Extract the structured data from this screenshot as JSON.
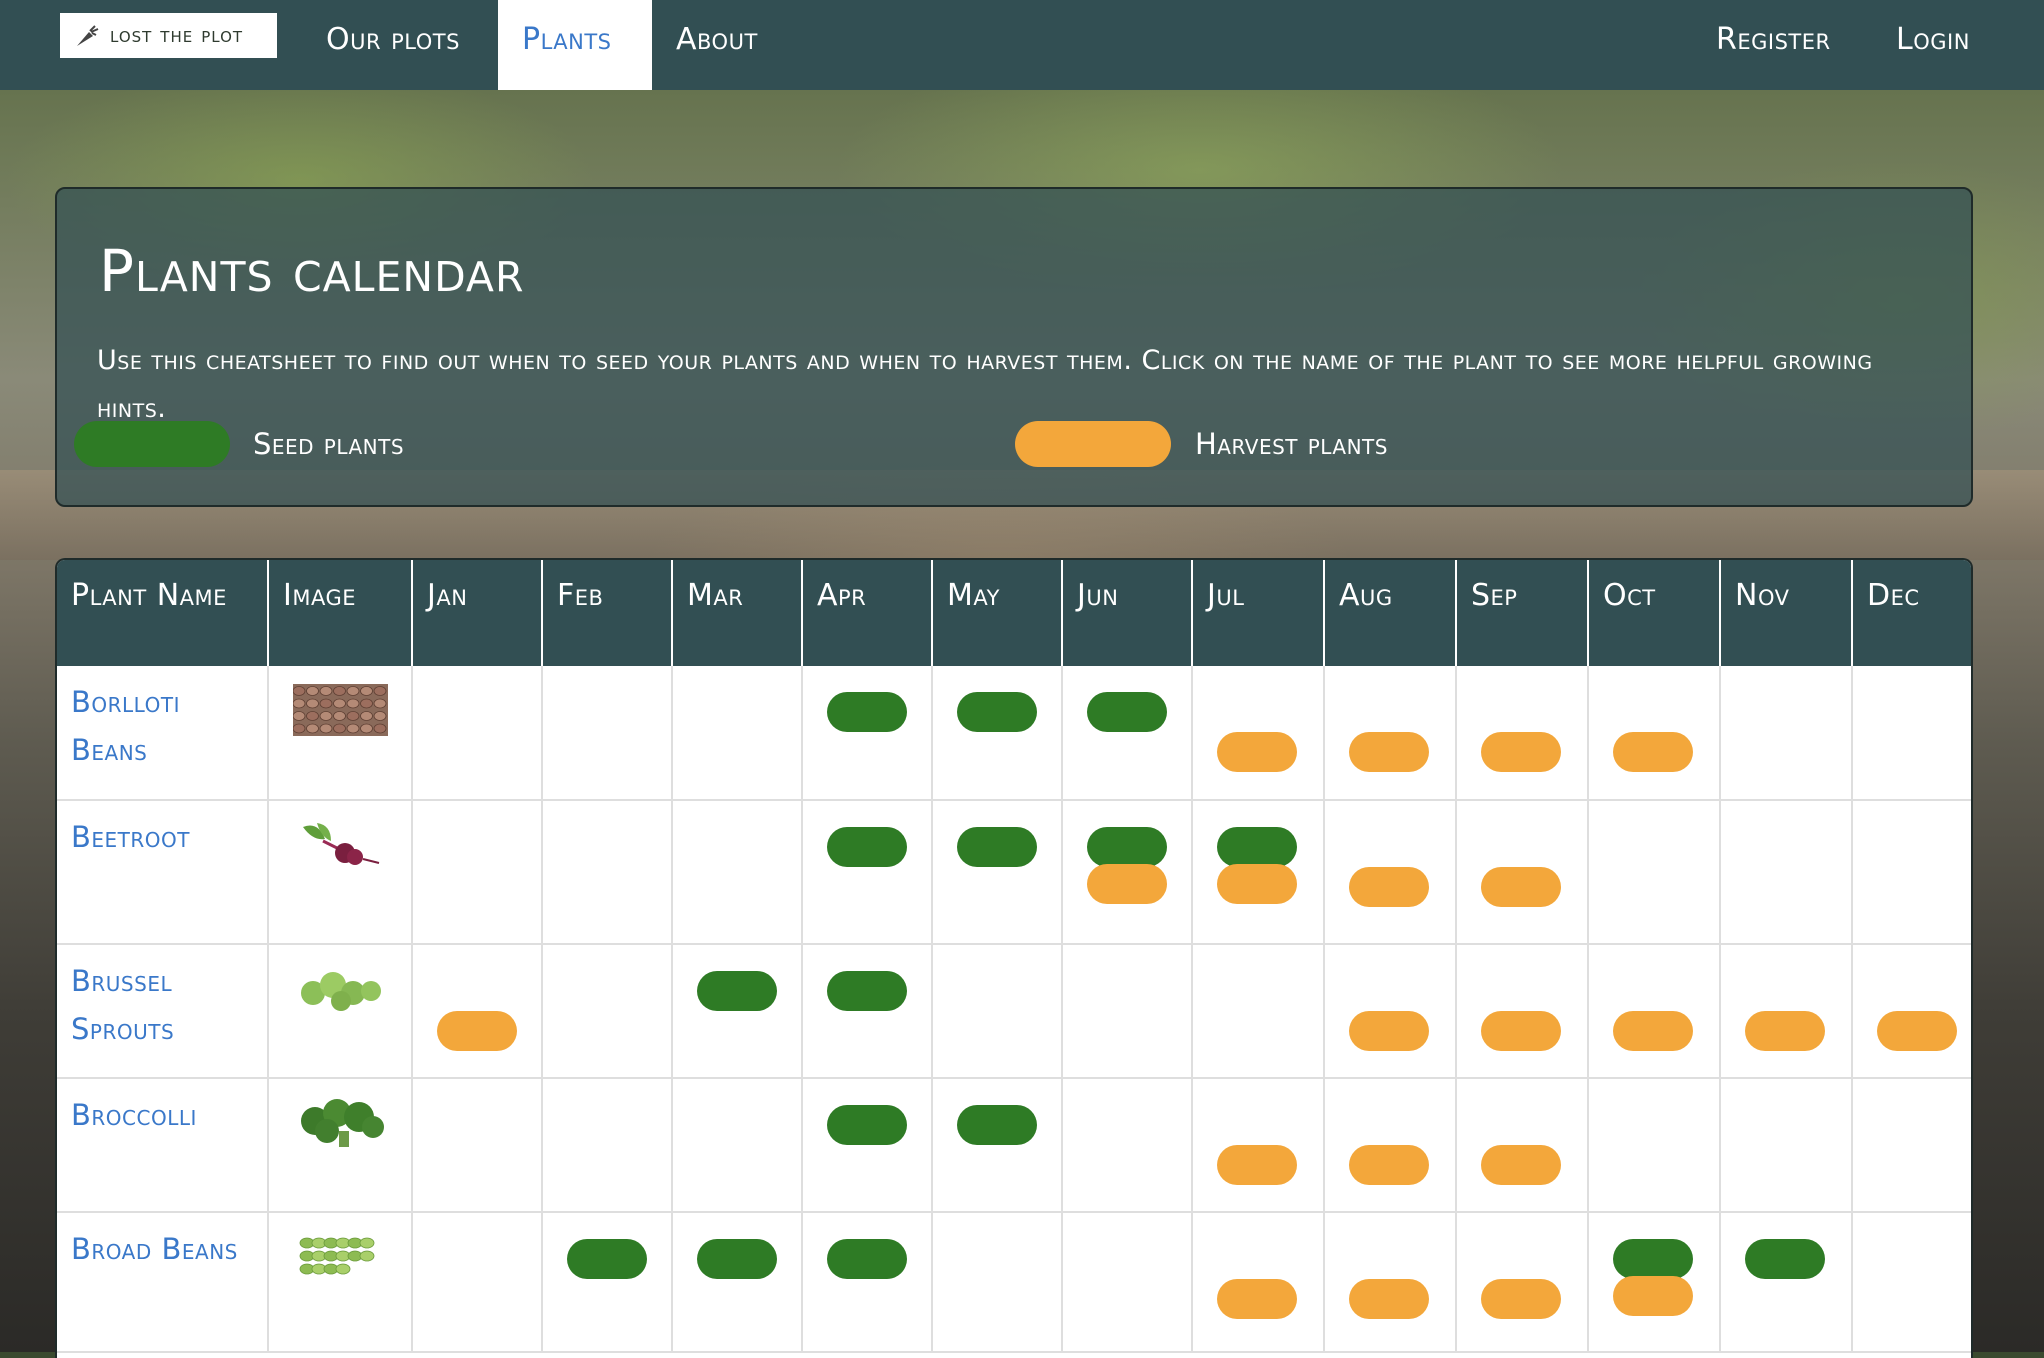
{
  "nav": {
    "brand": "lost the plot",
    "links": [
      {
        "label": "Our plots",
        "active": false
      },
      {
        "label": "Plants",
        "active": true
      },
      {
        "label": "About",
        "active": false
      }
    ],
    "register": "Register",
    "login": "Login"
  },
  "hero": {
    "title": "Plants calendar",
    "description": "Use this cheatsheet to find out when to seed your plants and when to harvest them. Click on the name of the plant to see more helpful growing hints.",
    "legend_seed": "Seed plants",
    "legend_harvest": "Harvest plants"
  },
  "colors": {
    "seed": "#2e7b25",
    "harvest": "#f3a73b",
    "nav_bg": "#324f53",
    "link": "#3a78c9"
  },
  "table": {
    "headers": [
      "Plant Name",
      "Image",
      "Jan",
      "Feb",
      "Mar",
      "Apr",
      "May",
      "Jun",
      "Jul",
      "Aug",
      "Sep",
      "Oct",
      "Nov",
      "Dec"
    ],
    "rows": [
      {
        "name": "Borlloti Beans",
        "image": "borlotti-beans-photo",
        "seed": [
          "Apr",
          "May",
          "Jun"
        ],
        "harvest": [
          "Jul",
          "Aug",
          "Sep",
          "Oct"
        ]
      },
      {
        "name": "Beetroot",
        "image": "beetroot-photo",
        "seed": [
          "Apr",
          "May",
          "Jun",
          "Jul"
        ],
        "harvest": [
          "Jun",
          "Jul",
          "Aug",
          "Sep"
        ]
      },
      {
        "name": "Brussel Sprouts",
        "image": "brussel-sprouts-photo",
        "seed": [
          "Mar",
          "Apr"
        ],
        "harvest": [
          "Jan",
          "Aug",
          "Sep",
          "Oct",
          "Nov",
          "Dec"
        ]
      },
      {
        "name": "Broccolli",
        "image": "broccoli-photo",
        "seed": [
          "Apr",
          "May"
        ],
        "harvest": [
          "Jul",
          "Aug",
          "Sep"
        ]
      },
      {
        "name": "Broad Beans",
        "image": "broad-beans-photo",
        "seed": [
          "Feb",
          "Mar",
          "Apr",
          "Oct",
          "Nov"
        ],
        "harvest": [
          "Jul",
          "Aug",
          "Sep",
          "Oct"
        ]
      }
    ]
  }
}
